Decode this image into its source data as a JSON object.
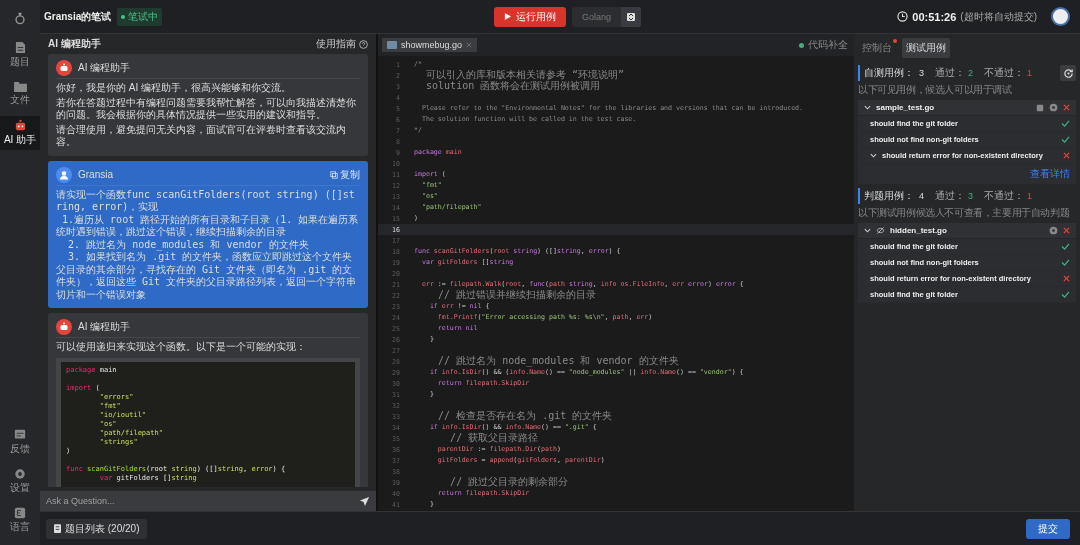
{
  "rail": {
    "top_items": [
      {
        "label": "题目",
        "kind": "doc",
        "selected": false
      },
      {
        "label": "文件",
        "kind": "folder",
        "selected": false
      },
      {
        "label": "AI 助手",
        "kind": "robot",
        "selected": true
      }
    ],
    "bottom_items": [
      {
        "label": "反馈",
        "kind": "feedback",
        "selected": false
      },
      {
        "label": "设置",
        "kind": "gear",
        "selected": false
      },
      {
        "label": "语言",
        "kind": "lang",
        "selected": false
      }
    ]
  },
  "header": {
    "title": "Gransia的笔试",
    "status": "笔试中",
    "run_button": "运行用例",
    "language": "Golang",
    "timer": "00:51:26",
    "timer_note": "(超时将自动提交)"
  },
  "assistant": {
    "title": "AI 编程助手",
    "guide": "使用指南",
    "input_placeholder": "Ask a Question...",
    "messages": [
      {
        "kind": "assistant",
        "name": "AI 编程助手",
        "paragraphs": [
          "你好，我是你的 AI 编程助手，很高兴能够和你交流。",
          "若你在答题过程中有编程问题需要我帮忙解答，可以向我描述清楚你的问题。我会根据你的具体情况提供一些实用的建议和指导。",
          "请合理使用，避免提问无关内容，面试官可在评卷时查看该交流内容。"
        ]
      },
      {
        "kind": "user",
        "name": "Gransia",
        "action": "复制",
        "paragraphs": [
          "请实现一个函数func scanGitFolders(root string) ([]string, error)，实现\n 1.遍历从 root 路径开始的所有目录和子目录（1. 如果在遍历系统时遇到错误，跳过这个错误，继续扫描剩余的目录\n  2. 跳过名为 node_modules 和 vendor 的文件夹\n  3. 如果找到名为 .git 的文件夹，函数应立即跳过这个文件夹父目录的其余部分，寻找存在的 Git 文件夹（即名为 .git 的文件夹），返回这些 Git 文件夹的父目录路径列表，返回一个字符串切片和一个错误对象"
        ]
      },
      {
        "kind": "assistant",
        "name": "AI 编程助手",
        "paragraphs": [
          "可以使用递归来实现这个函数。以下是一个可能的实现："
        ],
        "code": [
          {
            "gap_before": false,
            "segs": [
              {
                "kind": "kw",
                "text": "package"
              },
              {
                "kind": "pl",
                "text": " main"
              }
            ]
          },
          {
            "gap_before": true,
            "segs": [
              {
                "kind": "kw",
                "text": "import"
              },
              {
                "kind": "pl",
                "text": " ("
              }
            ]
          },
          {
            "gap_before": false,
            "segs": [
              {
                "kind": "str",
                "text": "        \"errors\""
              }
            ]
          },
          {
            "gap_before": false,
            "segs": [
              {
                "kind": "str",
                "text": "        \"fmt\""
              }
            ]
          },
          {
            "gap_before": false,
            "segs": [
              {
                "kind": "str",
                "text": "        \"io/ioutil\""
              }
            ]
          },
          {
            "gap_before": false,
            "segs": [
              {
                "kind": "str",
                "text": "        \"os\""
              }
            ]
          },
          {
            "gap_before": false,
            "segs": [
              {
                "kind": "str",
                "text": "        \"path/filepath\""
              }
            ]
          },
          {
            "gap_before": false,
            "segs": [
              {
                "kind": "str",
                "text": "        \"strings\""
              }
            ]
          },
          {
            "gap_before": false,
            "segs": [
              {
                "kind": "pl",
                "text": ")"
              }
            ]
          },
          {
            "gap_before": true,
            "segs": [
              {
                "kind": "kw",
                "text": "func"
              },
              {
                "kind": "id",
                "text": " scanGitFolders"
              },
              {
                "kind": "pl",
                "text": "(root "
              },
              {
                "kind": "str",
                "text": "string"
              },
              {
                "kind": "pl",
                "text": ") ([]"
              },
              {
                "kind": "str",
                "text": "string"
              },
              {
                "kind": "pl",
                "text": ", "
              },
              {
                "kind": "str",
                "text": "error"
              },
              {
                "kind": "pl",
                "text": ") {"
              }
            ]
          },
          {
            "gap_before": false,
            "segs": [
              {
                "kind": "kw",
                "text": "        var"
              },
              {
                "kind": "pl",
                "text": " gitFolders []"
              },
              {
                "kind": "str",
                "text": "string"
              }
            ]
          }
        ]
      }
    ]
  },
  "editor": {
    "tab": "showmebug.go",
    "autocomplete": "代码补全",
    "lines": [
      {
        "n": "1",
        "current": false,
        "segs": [
          {
            "kind": "cm",
            "text": "/*"
          }
        ]
      },
      {
        "n": "2",
        "current": false,
        "segs": [
          {
            "kind": "note",
            "text": "  可以引入的库和版本相关请参考 “环境说明”"
          }
        ]
      },
      {
        "n": "3",
        "current": false,
        "segs": [
          {
            "kind": "note",
            "text": "  solution 函数将会在测试用例被调用"
          }
        ]
      },
      {
        "n": "4",
        "current": false
      },
      {
        "n": "5",
        "current": false,
        "segs": [
          {
            "kind": "cm",
            "text": "  Please refer to the \"Environmental Notes\" for the libraries and versions that can be introduced."
          }
        ]
      },
      {
        "n": "6",
        "current": false,
        "segs": [
          {
            "kind": "cm",
            "text": "  The solution function will be called in the test case."
          }
        ]
      },
      {
        "n": "7",
        "current": false,
        "segs": [
          {
            "kind": "cm",
            "text": "*/"
          }
        ]
      },
      {
        "n": "8",
        "current": false
      },
      {
        "n": "9",
        "current": false,
        "segs": [
          {
            "kind": "kw",
            "text": "package"
          },
          {
            "kind": "id",
            "text": " main"
          }
        ]
      },
      {
        "n": "10",
        "current": false
      },
      {
        "n": "11",
        "current": false,
        "segs": [
          {
            "kind": "kw",
            "text": "import"
          },
          {
            "kind": "pl",
            "text": " ("
          }
        ]
      },
      {
        "n": "12",
        "current": false,
        "segs": [
          {
            "kind": "str",
            "text": "  \"fmt\""
          }
        ]
      },
      {
        "n": "13",
        "current": false,
        "segs": [
          {
            "kind": "str",
            "text": "  \"os\""
          }
        ]
      },
      {
        "n": "14",
        "current": false,
        "segs": [
          {
            "kind": "str",
            "text": "  \"path/filepath\""
          }
        ]
      },
      {
        "n": "15",
        "current": false,
        "segs": [
          {
            "kind": "pl",
            "text": ")"
          }
        ]
      },
      {
        "n": "16",
        "current": true
      },
      {
        "n": "17",
        "current": false
      },
      {
        "n": "18",
        "current": false,
        "segs": [
          {
            "kind": "kw",
            "text": "func"
          },
          {
            "kind": "id",
            "text": " scanGitFolders"
          },
          {
            "kind": "pl",
            "text": "("
          },
          {
            "kind": "id",
            "text": "root"
          },
          {
            "kind": "kw",
            "text": " string"
          },
          {
            "kind": "pl",
            "text": ") ([]"
          },
          {
            "kind": "kw",
            "text": "string"
          },
          {
            "kind": "pl",
            "text": ", "
          },
          {
            "kind": "kw",
            "text": "error"
          },
          {
            "kind": "pl",
            "text": ") {"
          }
        ]
      },
      {
        "n": "19",
        "current": false,
        "segs": [
          {
            "kind": "kw",
            "text": "  var"
          },
          {
            "kind": "id",
            "text": " gitFolders"
          },
          {
            "kind": "pl",
            "text": " []"
          },
          {
            "kind": "kw",
            "text": "string"
          }
        ]
      },
      {
        "n": "20",
        "current": false
      },
      {
        "n": "21",
        "current": false,
        "segs": [
          {
            "kind": "id",
            "text": "  err"
          },
          {
            "kind": "pl",
            "text": " := "
          },
          {
            "kind": "id",
            "text": "filepath.Walk"
          },
          {
            "kind": "pl",
            "text": "("
          },
          {
            "kind": "id",
            "text": "root"
          },
          {
            "kind": "pl",
            "text": ", "
          },
          {
            "kind": "kw",
            "text": "func"
          },
          {
            "kind": "pl",
            "text": "("
          },
          {
            "kind": "id",
            "text": "path"
          },
          {
            "kind": "kw",
            "text": " string"
          },
          {
            "kind": "pl",
            "text": ", "
          },
          {
            "kind": "id",
            "text": "info os.FileInfo"
          },
          {
            "kind": "pl",
            "text": ", "
          },
          {
            "kind": "id",
            "text": "err"
          },
          {
            "kind": "kw",
            "text": " error"
          },
          {
            "kind": "pl",
            "text": ") "
          },
          {
            "kind": "kw",
            "text": "error"
          },
          {
            "kind": "pl",
            "text": " {"
          }
        ]
      },
      {
        "n": "22",
        "current": false,
        "segs": [
          {
            "kind": "note",
            "text": "    // 跳过错误并继续扫描剩余的目录"
          }
        ]
      },
      {
        "n": "23",
        "current": false,
        "segs": [
          {
            "kind": "kw",
            "text": "    if"
          },
          {
            "kind": "id",
            "text": " err"
          },
          {
            "kind": "pl",
            "text": " != "
          },
          {
            "kind": "kw",
            "text": "nil"
          },
          {
            "kind": "pl",
            "text": " {"
          }
        ]
      },
      {
        "n": "24",
        "current": false,
        "segs": [
          {
            "kind": "id",
            "text": "      fmt.Printf"
          },
          {
            "kind": "pl",
            "text": "("
          },
          {
            "kind": "str",
            "text": "\"Error accessing path %s: %s\\n\""
          },
          {
            "kind": "pl",
            "text": ", "
          },
          {
            "kind": "id",
            "text": "path"
          },
          {
            "kind": "pl",
            "text": ", "
          },
          {
            "kind": "id",
            "text": "err"
          },
          {
            "kind": "pl",
            "text": ")"
          }
        ]
      },
      {
        "n": "25",
        "current": false,
        "segs": [
          {
            "kind": "kw",
            "text": "      return nil"
          }
        ]
      },
      {
        "n": "26",
        "current": false,
        "segs": [
          {
            "kind": "pl",
            "text": "    }"
          }
        ]
      },
      {
        "n": "27",
        "current": false
      },
      {
        "n": "28",
        "current": false,
        "segs": [
          {
            "kind": "note",
            "text": "    // 跳过名为 node_modules 和 vendor 的文件夹"
          }
        ]
      },
      {
        "n": "29",
        "current": false,
        "segs": [
          {
            "kind": "kw",
            "text": "    if"
          },
          {
            "kind": "id",
            "text": " info.IsDir"
          },
          {
            "kind": "pl",
            "text": "() && ("
          },
          {
            "kind": "id",
            "text": "info.Name"
          },
          {
            "kind": "pl",
            "text": "() == "
          },
          {
            "kind": "str",
            "text": "\"node_modules\""
          },
          {
            "kind": "pl",
            "text": " || "
          },
          {
            "kind": "id",
            "text": "info.Name"
          },
          {
            "kind": "pl",
            "text": "() == "
          },
          {
            "kind": "str",
            "text": "\"vendor\""
          },
          {
            "kind": "pl",
            "text": ") {"
          }
        ]
      },
      {
        "n": "30",
        "current": false,
        "segs": [
          {
            "kind": "kw",
            "text": "      return"
          },
          {
            "kind": "id",
            "text": " filepath.SkipDir"
          }
        ]
      },
      {
        "n": "31",
        "current": false,
        "segs": [
          {
            "kind": "pl",
            "text": "    }"
          }
        ]
      },
      {
        "n": "32",
        "current": false
      },
      {
        "n": "33",
        "current": false,
        "segs": [
          {
            "kind": "note",
            "text": "    // 检查是否存在名为 .git 的文件夹"
          }
        ]
      },
      {
        "n": "34",
        "current": false,
        "segs": [
          {
            "kind": "kw",
            "text": "    if"
          },
          {
            "kind": "id",
            "text": " info.IsDir"
          },
          {
            "kind": "pl",
            "text": "() && "
          },
          {
            "kind": "id",
            "text": "info.Name"
          },
          {
            "kind": "pl",
            "text": "() == "
          },
          {
            "kind": "str",
            "text": "\".git\""
          },
          {
            "kind": "pl",
            "text": " {"
          }
        ]
      },
      {
        "n": "35",
        "current": false,
        "segs": [
          {
            "kind": "note",
            "text": "      // 获取父目录路径"
          }
        ]
      },
      {
        "n": "36",
        "current": false,
        "segs": [
          {
            "kind": "id",
            "text": "      parentDir"
          },
          {
            "kind": "pl",
            "text": " := "
          },
          {
            "kind": "id",
            "text": "filepath.Dir"
          },
          {
            "kind": "pl",
            "text": "("
          },
          {
            "kind": "id",
            "text": "path"
          },
          {
            "kind": "pl",
            "text": ")"
          }
        ]
      },
      {
        "n": "37",
        "current": false,
        "segs": [
          {
            "kind": "id",
            "text": "      gitFolders"
          },
          {
            "kind": "pl",
            "text": " = "
          },
          {
            "kind": "id",
            "text": "append"
          },
          {
            "kind": "pl",
            "text": "("
          },
          {
            "kind": "id",
            "text": "gitFolders"
          },
          {
            "kind": "pl",
            "text": ", "
          },
          {
            "kind": "id",
            "text": "parentDir"
          },
          {
            "kind": "pl",
            "text": ")"
          }
        ]
      },
      {
        "n": "38",
        "current": false
      },
      {
        "n": "39",
        "current": false,
        "segs": [
          {
            "kind": "note",
            "text": "      // 跳过父目录的剩余部分"
          }
        ]
      },
      {
        "n": "40",
        "current": false,
        "segs": [
          {
            "kind": "kw",
            "text": "      return"
          },
          {
            "kind": "id",
            "text": " filepath.SkipDir"
          }
        ]
      },
      {
        "n": "41",
        "current": false,
        "segs": [
          {
            "kind": "pl",
            "text": "    }"
          }
        ]
      }
    ]
  },
  "tests": {
    "tabs": [
      {
        "label": "控制台",
        "selected": false,
        "dot": true
      },
      {
        "label": "测试用例",
        "selected": true,
        "dot": false
      }
    ],
    "sections": [
      {
        "title": "自测用例：",
        "total": "3",
        "pass_label": "通过：",
        "pass": "2",
        "fail_label": "不通过：",
        "fail": "1",
        "refresh": true,
        "note": "以下可见用例，候选人可以用于调试",
        "link": "查看详情",
        "file": {
          "name": "sample_test.go",
          "hidden": false,
          "expanded": true
        },
        "cases": [
          {
            "name": "should find the git folder",
            "passed": true,
            "expandable": false
          },
          {
            "name": "should not find non-git folders",
            "passed": true,
            "expandable": false
          },
          {
            "name": "should return error for non-existent directory",
            "passed": false,
            "expandable": true
          }
        ]
      },
      {
        "title": "判题用例：",
        "total": "4",
        "pass_label": "通过：",
        "pass": "3",
        "fail_label": "不通过：",
        "fail": "1",
        "refresh": false,
        "note": "以下测试用例候选人不可查看，主要用于自动判题",
        "file": {
          "name": "hidden_test.go",
          "hidden": true,
          "expanded": true
        },
        "cases": [
          {
            "name": "should find the git folder",
            "passed": true,
            "expandable": false
          },
          {
            "name": "should not find non-git folders",
            "passed": true,
            "expandable": false
          },
          {
            "name": "should return error for non-existent directory",
            "passed": false,
            "expandable": false
          },
          {
            "name": "should find the git folder",
            "passed": true,
            "expandable": false
          }
        ]
      }
    ]
  },
  "footer": {
    "problem_list": "题目列表 (20/20)",
    "submit": "提交"
  }
}
